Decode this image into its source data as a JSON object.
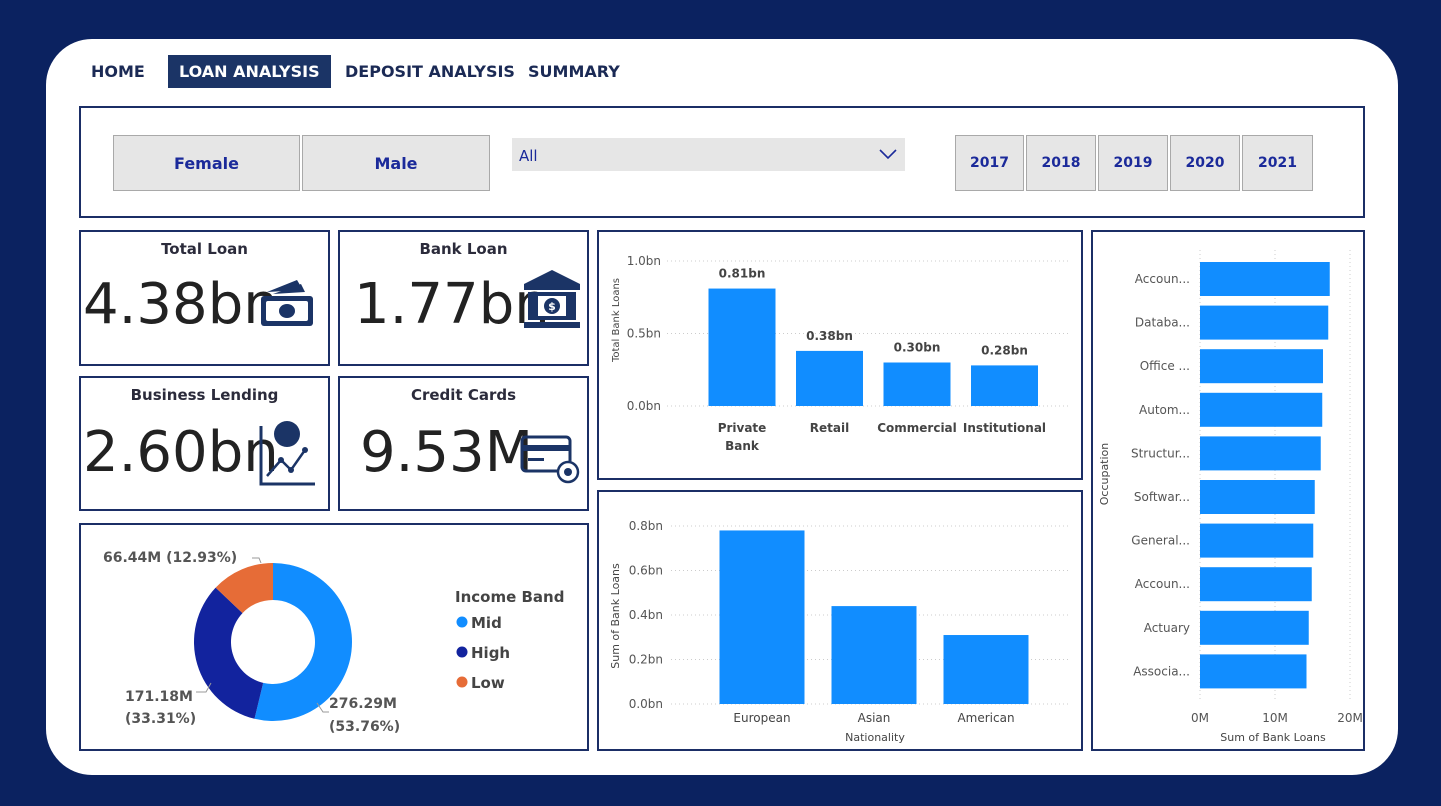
{
  "nav": {
    "tabs": [
      {
        "label": "HOME",
        "active": false
      },
      {
        "label": "LOAN ANALYSIS",
        "active": true
      },
      {
        "label": "DEPOSIT ANALYSIS",
        "active": false
      },
      {
        "label": "SUMMARY",
        "active": false
      }
    ]
  },
  "filters": {
    "gender": [
      "Female",
      "Male"
    ],
    "dropdown_value": "All",
    "years": [
      "2017",
      "2018",
      "2019",
      "2020",
      "2021"
    ]
  },
  "kpis": {
    "total_loan": {
      "title": "Total Loan",
      "value": "4.38bn",
      "icon": "money-icon"
    },
    "bank_loan": {
      "title": "Bank Loan",
      "value": "1.77bn",
      "icon": "bank-icon"
    },
    "business_lending": {
      "title": "Business Lending",
      "value": "2.60bn",
      "icon": "growth-chart-icon"
    },
    "credit_cards": {
      "title": "Credit Cards",
      "value": "9.53M",
      "icon": "credit-card-icon"
    }
  },
  "chart_data": [
    {
      "id": "income-band-donut",
      "type": "pie",
      "legend_title": "Income Band",
      "legend_position": "right",
      "slices": [
        {
          "name": "Mid",
          "value": 276.29,
          "label_line1": "276.29M",
          "label_line2": "(53.76%)",
          "color": "#118dff"
        },
        {
          "name": "High",
          "value": 171.18,
          "label_line1": "171.18M",
          "label_line2": "(33.31%)",
          "color": "#12239e"
        },
        {
          "name": "Low",
          "value": 66.44,
          "label": "66.44M (12.93%)",
          "color": "#e66c37"
        }
      ]
    },
    {
      "id": "bank-type-bar",
      "type": "bar",
      "ylabel": "Total Bank Loans",
      "yticks": [
        "0.0bn",
        "0.5bn",
        "1.0bn"
      ],
      "ylim": [
        0,
        1.0
      ],
      "categories": [
        [
          "Private",
          "Bank"
        ],
        [
          "Retail"
        ],
        [
          "Commercial"
        ],
        [
          "Institutional"
        ]
      ],
      "values": [
        0.81,
        0.38,
        0.3,
        0.28
      ],
      "data_labels": [
        "0.81bn",
        "0.38bn",
        "0.30bn",
        "0.28bn"
      ],
      "color": "#118dff",
      "grid": true
    },
    {
      "id": "nationality-bar",
      "type": "bar",
      "xlabel": "Nationality",
      "ylabel": "Sum of Bank Loans",
      "yticks": [
        "0.0bn",
        "0.2bn",
        "0.4bn",
        "0.6bn",
        "0.8bn"
      ],
      "ylim": [
        0,
        0.8
      ],
      "categories": [
        "European",
        "Asian",
        "American"
      ],
      "values": [
        0.78,
        0.44,
        0.31
      ],
      "color": "#118dff",
      "grid": true
    },
    {
      "id": "occupation-hbar",
      "type": "bar",
      "orientation": "horizontal",
      "xlabel": "Sum of Bank Loans",
      "ylabel": "Occupation",
      "xticks": [
        "0M",
        "10M",
        "20M"
      ],
      "xlim": [
        0,
        20
      ],
      "categories": [
        "Accoun...",
        "Databa...",
        "Office ...",
        "Autom...",
        "Structur...",
        "Softwar...",
        "General...",
        "Accoun...",
        "Actuary",
        "Associa..."
      ],
      "values": [
        17.3,
        17.1,
        16.4,
        16.3,
        16.1,
        15.3,
        15.1,
        14.9,
        14.5,
        14.2
      ],
      "color": "#118dff",
      "grid": true
    }
  ]
}
